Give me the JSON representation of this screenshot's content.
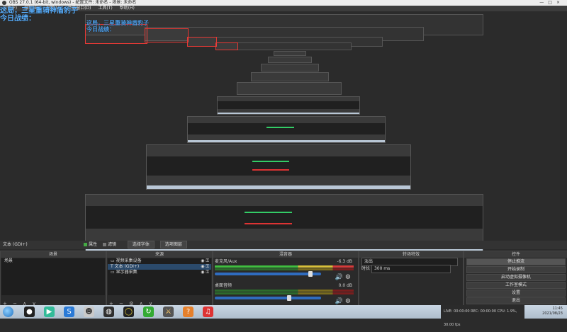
{
  "window": {
    "title": "OBS 27.0.1 (64-bit, windows) - 配置文件: 未命名 - 场景: 未命名",
    "buttons": [
      "—",
      "□",
      "×"
    ]
  },
  "menu": [
    "文件(F)",
    "编辑(E)",
    "视图(V)",
    "停靠窗口(D)",
    "工具(T)",
    "帮助(H)"
  ],
  "overlay": {
    "line1": "这局，三星重骑神盾豹子",
    "line2": "今日战绩："
  },
  "source_bar": {
    "source_name": "文本 (GDI+)",
    "properties_label": "属性",
    "filters_label": "滤镜",
    "tab1": "选择字体",
    "tab2": "选项图层"
  },
  "scenes": {
    "header": "场景",
    "items": [
      "场景"
    ],
    "toolbar": "+ − ∧ ∨"
  },
  "sources": {
    "header": "来源",
    "items": [
      {
        "icon": "monitor-icon",
        "label": "视频采集设备"
      },
      {
        "icon": "text-icon",
        "label": "文本 (GDI+)"
      },
      {
        "icon": "display-icon",
        "label": "显示器采集"
      }
    ],
    "toolbar": "+ − ⚙ ∧ ∨"
  },
  "mixer": {
    "header": "混音器",
    "channels": [
      {
        "name": "麦克风/Aux",
        "db": "-6.3 dB",
        "volume_pct": 90
      },
      {
        "name": "桌面音频",
        "db": "0.0 dB",
        "volume_pct": 70
      }
    ]
  },
  "transitions": {
    "header": "转场特效",
    "selected": "淡出",
    "duration_label": "时长",
    "duration_value": "300 ms"
  },
  "controls": {
    "header": "控件",
    "buttons": [
      "停止推流",
      "开始录制",
      "启动虚拟摄像机",
      "工作室模式",
      "设置",
      "退出"
    ],
    "active_index": 0
  },
  "status": {
    "live": "LIVE: 00:00:00",
    "rec": "REC: 00:00:00",
    "cpu": "CPU: 1.9%, 30.00 fps"
  },
  "clock": {
    "time": "11:45",
    "date": "2021/08/23"
  },
  "colors": {
    "overlay_text": "#5ab0ff",
    "highlight_box": "#e53935",
    "background": "#2b2b2b"
  },
  "taskbar_icons": [
    "start-orb-icon",
    "qq-penguin-icon",
    "video-player-icon",
    "sogou-input-icon",
    "game-character-icon",
    "obs-icon",
    "ring-app-icon",
    "refresh-app-icon",
    "sword-game-icon",
    "browser-icon",
    "netease-music-icon"
  ]
}
